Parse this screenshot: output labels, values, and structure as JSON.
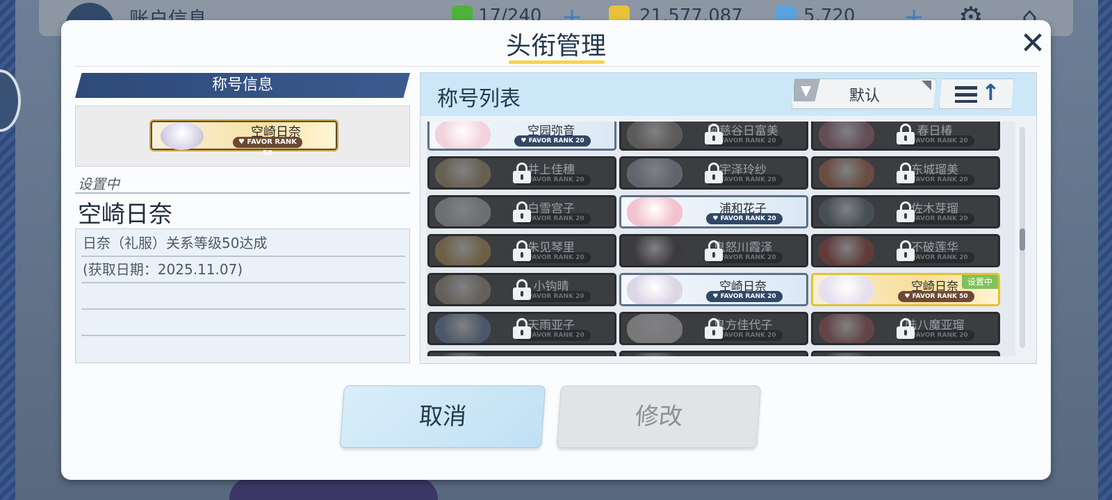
{
  "topbar": {
    "account_title": "账户信息",
    "ap": "17/240",
    "credits": "21,577,087",
    "gems": "5,720"
  },
  "modal": {
    "title": "头衔管理",
    "close_icon": "close-icon"
  },
  "info": {
    "header": "称号信息",
    "preview": {
      "name": "空崎日奈",
      "rank": "FAVOR RANK 50"
    },
    "setting_label": "设置中",
    "setting_name": "空崎日奈",
    "desc_lines": [
      "日奈（礼服）关系等级50达成",
      "(获取日期：2025.11.07)",
      "",
      "",
      ""
    ]
  },
  "list": {
    "title": "称号列表",
    "filter_label": "默认",
    "filter_icon": "filter-icon",
    "sort_icon": "sort-ascending-icon",
    "cards": [
      {
        "name": "空园弥音",
        "rank": "FAVOR RANK 20",
        "state": "unlocked",
        "face": "#f3d2dc"
      },
      {
        "name": "阿慈谷日富美",
        "rank": "FAVOR RANK 20",
        "state": "locked",
        "face": "#9b8f86"
      },
      {
        "name": "春日椿",
        "rank": "FAVOR RANK 20",
        "state": "locked",
        "face": "#b06a7c"
      },
      {
        "name": "井上佳穗",
        "rank": "FAVOR RANK 20",
        "state": "locked",
        "face": "#b8a070"
      },
      {
        "name": "宇泽玲纱",
        "rank": "FAVOR RANK 20",
        "state": "locked",
        "face": "#a8aec0"
      },
      {
        "name": "东城瑠美",
        "rank": "FAVOR RANK 20",
        "state": "locked",
        "face": "#c06848"
      },
      {
        "name": "白雪宫子",
        "rank": "FAVOR RANK 20",
        "state": "locked",
        "face": "#c9c9cf"
      },
      {
        "name": "浦和花子",
        "rank": "FAVOR RANK 20",
        "state": "unlocked",
        "face": "#f2c2ce"
      },
      {
        "name": "佐木芽瑠",
        "rank": "FAVOR RANK 20",
        "state": "locked",
        "face": "#5d6e78"
      },
      {
        "name": "朱见琴里",
        "rank": "FAVOR RANK 20",
        "state": "locked",
        "face": "#c9a04a"
      },
      {
        "name": "鬼怒川霞泽",
        "rank": "FAVOR RANK 20",
        "state": "locked",
        "face": "#40383a"
      },
      {
        "name": "不破莲华",
        "rank": "FAVOR RANK 20",
        "state": "locked",
        "face": "#a8382e"
      },
      {
        "name": "小钩晴",
        "rank": "FAVOR RANK 20",
        "state": "locked",
        "face": "#b0a088"
      },
      {
        "name": "空崎日奈",
        "rank": "FAVOR RANK 20",
        "state": "unlocked",
        "face": "#dcd6e6"
      },
      {
        "name": "空崎日奈",
        "rank": "FAVOR RANK 50",
        "state": "selected",
        "face": "#e6e0ee",
        "badge": "设置中"
      },
      {
        "name": "天雨亚子",
        "rank": "FAVOR RANK 20",
        "state": "locked",
        "face": "#6c8ab8"
      },
      {
        "name": "鬼方佳代子",
        "rank": "FAVOR RANK 20",
        "state": "locked",
        "face": "#e8e4e2"
      },
      {
        "name": "陆八魔亚瑠",
        "rank": "FAVOR RANK 20",
        "state": "locked",
        "face": "#b05050"
      },
      {
        "name": "",
        "rank": "",
        "state": "locked",
        "face": "#555"
      },
      {
        "name": "",
        "rank": "",
        "state": "locked",
        "face": "#555"
      },
      {
        "name": "",
        "rank": "",
        "state": "locked",
        "face": "#555"
      }
    ]
  },
  "buttons": {
    "cancel": "取消",
    "modify": "修改"
  },
  "colors": {
    "accent": "#f5d64a",
    "header_blue": "#2d4a78",
    "selected_gold": "#e2c22e"
  }
}
